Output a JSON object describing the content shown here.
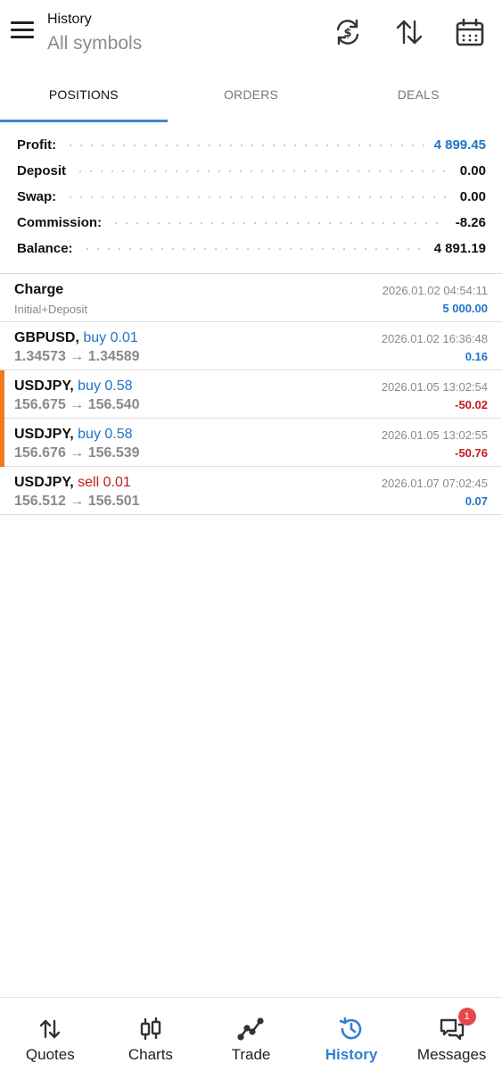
{
  "header": {
    "title": "History",
    "subtitle": "All symbols",
    "icons": [
      "menu-icon",
      "currency-refresh-icon",
      "sort-arrows-icon",
      "calendar-icon"
    ]
  },
  "tabs": [
    {
      "label": "POSITIONS",
      "active": true
    },
    {
      "label": "ORDERS",
      "active": false
    },
    {
      "label": "DEALS",
      "active": false
    }
  ],
  "summary": {
    "profit_label": "Profit:",
    "profit_value": "4 899.45",
    "deposit_label": "Deposit",
    "deposit_value": "0.00",
    "swap_label": "Swap:",
    "swap_value": "0.00",
    "commission_label": "Commission:",
    "commission_value": "-8.26",
    "balance_label": "Balance:",
    "balance_value": "4 891.19"
  },
  "deals": [
    {
      "symbol": "Charge",
      "side": "",
      "detail": "Initial+Deposit",
      "time": "2026.01.02 04:54:11",
      "amount": "5 000.00",
      "amount_sign": "pos",
      "marked": false
    },
    {
      "symbol": "GBPUSD,",
      "side": "buy 0.01",
      "side_type": "buy",
      "detail": "1.34573 → 1.34589",
      "time": "2026.01.02 16:36:48",
      "amount": "0.16",
      "amount_sign": "pos",
      "marked": false
    },
    {
      "symbol": "USDJPY,",
      "side": "buy 0.58",
      "side_type": "buy",
      "detail": "156.675 → 156.540",
      "time": "2026.01.05 13:02:54",
      "amount": "-50.02",
      "amount_sign": "neg",
      "marked": true
    },
    {
      "symbol": "USDJPY,",
      "side": "buy 0.58",
      "side_type": "buy",
      "detail": "156.676 → 156.539",
      "time": "2026.01.05 13:02:55",
      "amount": "-50.76",
      "amount_sign": "neg",
      "marked": true
    },
    {
      "symbol": "USDJPY,",
      "side": "sell 0.01",
      "side_type": "sell",
      "detail": "156.512 → 156.501",
      "time": "2026.01.07 07:02:45",
      "amount": "0.07",
      "amount_sign": "pos",
      "marked": false
    }
  ],
  "nav": [
    {
      "label": "Quotes",
      "icon": "quotes-arrows-icon",
      "active": false
    },
    {
      "label": "Charts",
      "icon": "candlestick-icon",
      "active": false
    },
    {
      "label": "Trade",
      "icon": "trade-line-icon",
      "active": false
    },
    {
      "label": "History",
      "icon": "history-clock-icon",
      "active": true
    },
    {
      "label": "Messages",
      "icon": "messages-icon",
      "active": false,
      "badge": "1"
    }
  ],
  "colors": {
    "accent": "#2f80d2",
    "positive": "#1f74c7",
    "negative": "#c41a1a",
    "marker": "#f07a1e",
    "badge": "#e5484d"
  }
}
